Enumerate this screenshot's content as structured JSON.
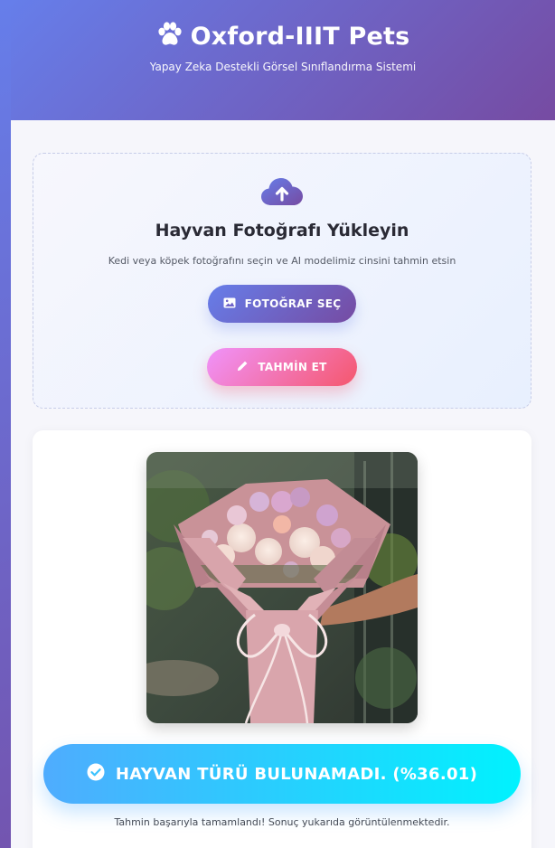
{
  "header": {
    "title": "Oxford-IIIT Pets",
    "subtitle": "Yapay Zeka Destekli Görsel Sınıflandırma Sistemi",
    "icon": "paw-icon"
  },
  "upload": {
    "icon": "cloud-upload-icon",
    "title": "Hayvan Fotoğrafı Yükleyin",
    "description": "Kedi veya köpek fotoğrafını seçin ve AI modelimiz cinsini tahmin etsin",
    "select_button": {
      "label": "FOTOĞRAF SEÇ",
      "icon": "image-icon"
    },
    "predict_button": {
      "label": "TAHMİN ET",
      "icon": "pencil-icon"
    }
  },
  "result": {
    "image_alt": "Uploaded photo: pink flower bouquet",
    "status_icon": "check-circle-icon",
    "label": "HAYVAN TÜRÜ BULUNAMADI. (%36.01)",
    "note": "Tahmin başarıyla tamamlandı! Sonuç yukarıda görüntülenmektedir."
  },
  "colors": {
    "brand_gradient_start": "#667eea",
    "brand_gradient_end": "#764ba2",
    "predict_gradient_start": "#f093fb",
    "predict_gradient_end": "#f5576c",
    "result_gradient_start": "#4facfe",
    "result_gradient_end": "#00f2fe"
  }
}
